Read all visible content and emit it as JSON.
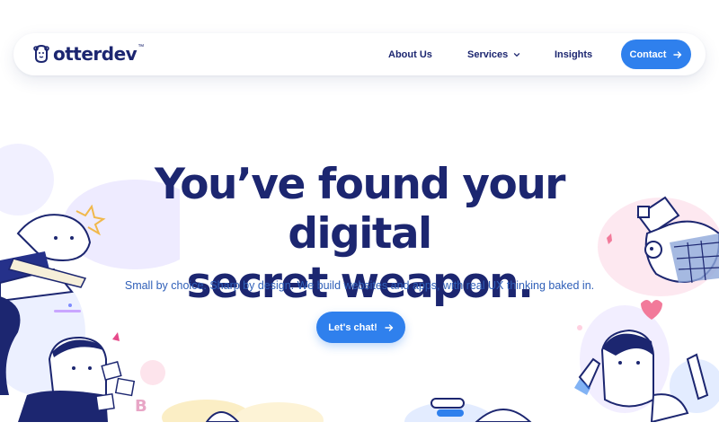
{
  "brand": {
    "name": "otterdev",
    "trademark": "™",
    "logo_icon": "otter-head-icon"
  },
  "nav": {
    "links": [
      {
        "label": "About Us"
      },
      {
        "label": "Services",
        "icon": "chevron-down-icon"
      },
      {
        "label": "Insights"
      }
    ],
    "contact_label": "Contact",
    "contact_icon": "arrow-right-icon"
  },
  "hero": {
    "title_line1": "You’ve found your digital",
    "title_line2": "secret weapon.",
    "subtitle": "Small by choice. Sharp by design. We build websites and apps, with real UX thinking baked in.",
    "cta_label": "Let's chat!",
    "cta_icon": "arrow-right-icon"
  },
  "colors": {
    "navy": "#1c2670",
    "accent": "#2f80ed",
    "subtitle": "#2f5fb8"
  }
}
